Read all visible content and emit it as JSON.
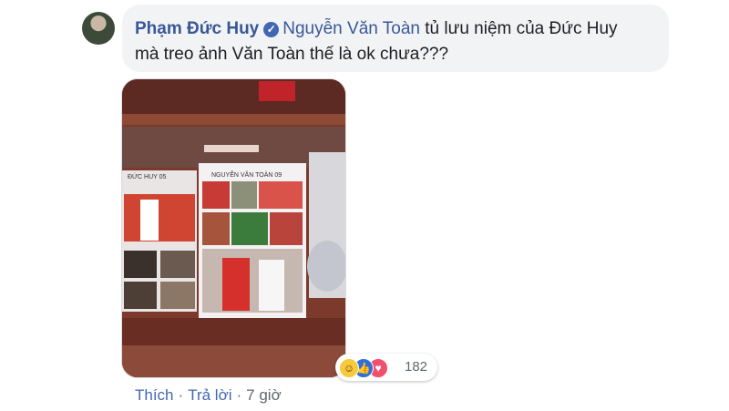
{
  "comment": {
    "author": "Phạm Đức Huy",
    "mention": "Nguyễn Văn Toàn",
    "text_line1": " tủ lưu niệm của Đức Huy",
    "text_line2": "mà treo ảnh Văn Toàn thế là ok chưa???"
  },
  "photo": {
    "book_left_caption": "ĐỨC HUY 05",
    "book_right_caption": "NGUYỄN VĂN TOÀN 09"
  },
  "reactions": {
    "icons": [
      "haha-icon",
      "like-icon",
      "love-icon"
    ],
    "count": "182",
    "colors": {
      "haha": "#f7c93c",
      "like": "#2f6fd9",
      "love": "#f0506e"
    }
  },
  "actions": {
    "like_label": "Thích",
    "reply_label": "Trả lời",
    "separator": "·",
    "timestamp": "7 giờ"
  },
  "colors": {
    "author": "#385898",
    "bubble": "#f2f3f5",
    "meta": "#606770"
  }
}
